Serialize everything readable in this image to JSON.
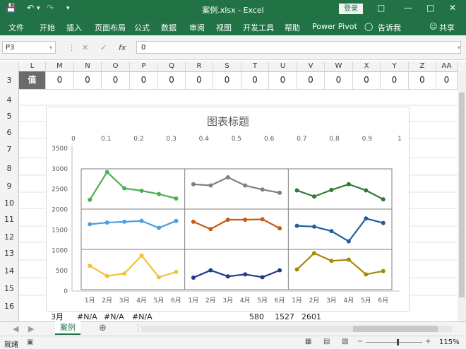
{
  "app": {
    "title": "案例.xlsx  -  Excel",
    "login": "登录"
  },
  "ribbon_tabs": [
    "文件",
    "开始",
    "插入",
    "页面布局",
    "公式",
    "数据",
    "审阅",
    "视图",
    "开发工具",
    "帮助",
    "Power Pivot",
    "告诉我",
    "共享"
  ],
  "formula_bar": {
    "name_box": "P3",
    "formula": "0"
  },
  "columns": [
    "L",
    "M",
    "N",
    "O",
    "P",
    "Q",
    "R",
    "S",
    "T",
    "U",
    "V",
    "W",
    "X",
    "Y",
    "Z",
    "AA"
  ],
  "rows": [
    "3",
    "4",
    "5",
    "6",
    "7",
    "8",
    "9",
    "10",
    "11",
    "12",
    "13",
    "14",
    "15",
    "16"
  ],
  "row3": {
    "label": "值",
    "values": [
      "0",
      "0",
      "0",
      "0",
      "0",
      "0",
      "0",
      "0",
      "0",
      "0",
      "0",
      "0",
      "0",
      "0",
      "0"
    ]
  },
  "row16": [
    "3月",
    "#N/A",
    "#N/A",
    "#N/A",
    "580",
    "1527",
    "2601"
  ],
  "sheet": {
    "tab": "案例"
  },
  "status": {
    "left": "就绪",
    "zoom": "115%"
  },
  "colors": {
    "accent": "#217346"
  },
  "chart_data": {
    "type": "line",
    "title": "图表标题",
    "top_axis_ticks": [
      "0",
      "0.1",
      "0.2",
      "0.3",
      "0.4",
      "0.5",
      "0.6",
      "0.7",
      "0.8",
      "0.9",
      "1"
    ],
    "y_ticks": [
      "3500",
      "3000",
      "2500",
      "2000",
      "1500",
      "1000",
      "500",
      "0"
    ],
    "ylim": [
      0,
      3500
    ],
    "categories": [
      "1月",
      "2月",
      "3月",
      "4月",
      "5月",
      "6月"
    ],
    "panels": [
      {
        "row": 0,
        "col": 0,
        "color": "#4caf50",
        "values": [
          2240,
          2920,
          2520,
          2460,
          2380,
          2270
        ]
      },
      {
        "row": 0,
        "col": 1,
        "color": "#808080",
        "values": [
          2620,
          2590,
          2790,
          2590,
          2490,
          2410
        ]
      },
      {
        "row": 0,
        "col": 2,
        "color": "#2e7d32",
        "values": [
          2470,
          2320,
          2480,
          2620,
          2470,
          2250
        ]
      },
      {
        "row": 1,
        "col": 0,
        "color": "#4a9fde",
        "values": [
          1640,
          1680,
          1700,
          1720,
          1550,
          1720
        ]
      },
      {
        "row": 1,
        "col": 1,
        "color": "#c55a11",
        "values": [
          1700,
          1520,
          1750,
          1750,
          1760,
          1540
        ]
      },
      {
        "row": 1,
        "col": 2,
        "color": "#1f5fa0",
        "values": [
          1600,
          1580,
          1470,
          1220,
          1780,
          1670
        ]
      },
      {
        "row": 2,
        "col": 0,
        "color": "#f1c232",
        "values": [
          620,
          370,
          430,
          870,
          340,
          470
        ]
      },
      {
        "row": 2,
        "col": 1,
        "color": "#1f3c88",
        "values": [
          330,
          510,
          360,
          410,
          340,
          510
        ]
      },
      {
        "row": 2,
        "col": 2,
        "color": "#a68a00",
        "values": [
          530,
          930,
          740,
          770,
          410,
          490
        ]
      }
    ]
  }
}
